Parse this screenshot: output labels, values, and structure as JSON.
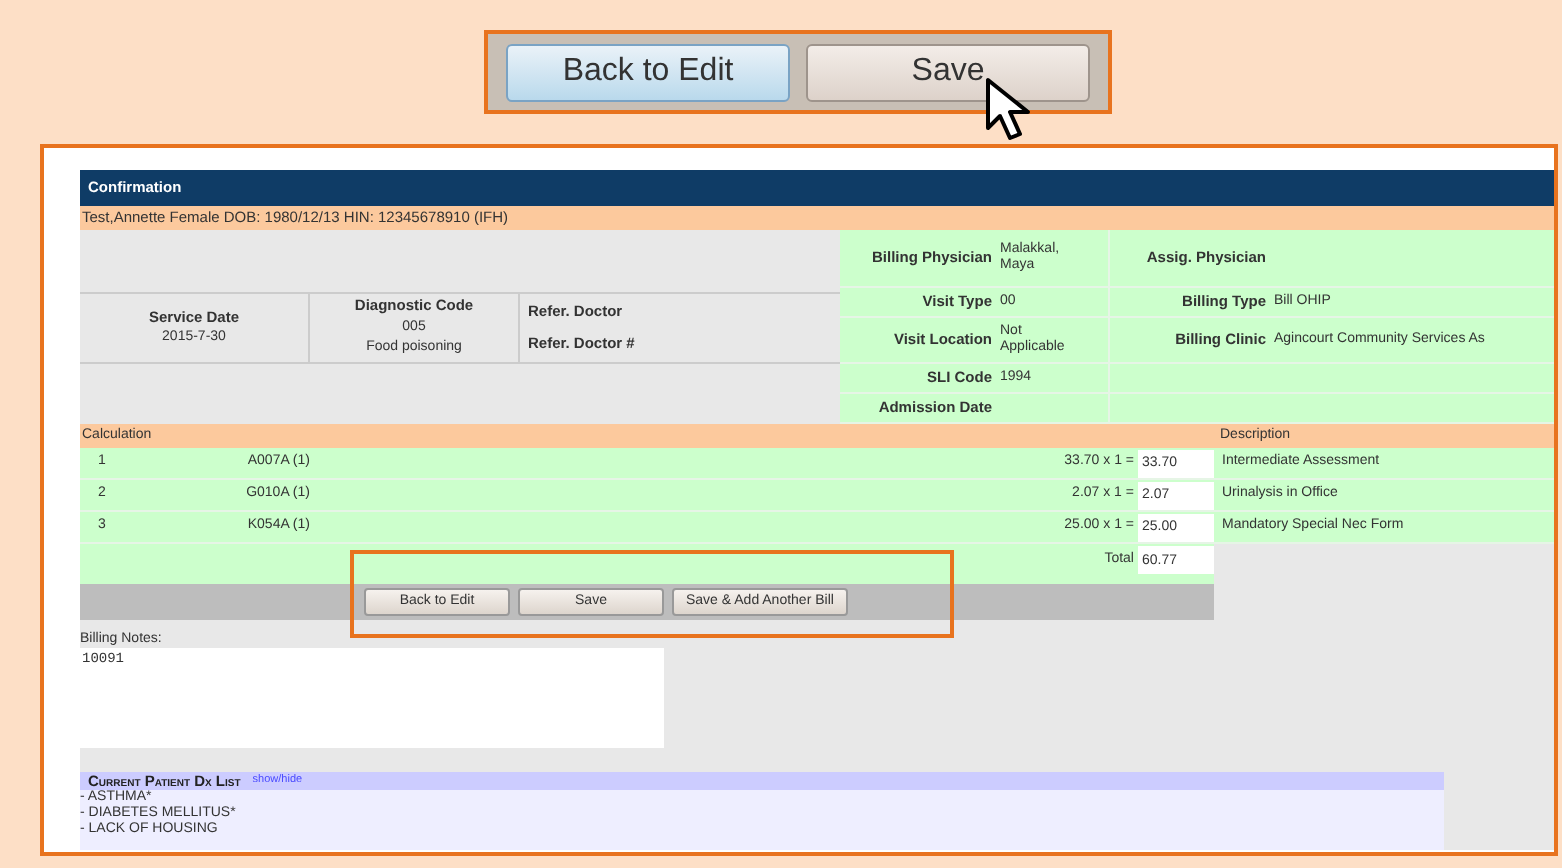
{
  "callout_buttons": [
    {
      "label": "Back to Edit",
      "focused": true
    },
    {
      "label": "Save",
      "focused": false
    }
  ],
  "window": {
    "title": "Confirmation"
  },
  "patient_banner": "Test,Annette Female DOB: 1980/12/13 HIN: 12345678910 (IFH)",
  "service": {
    "service_date_label": "Service Date",
    "service_date": "2015-7-30",
    "diagnostic_label": "Diagnostic Code",
    "diagnostic_code": "005",
    "diagnostic_name": "Food poisoning",
    "refer_doctor_label": "Refer. Doctor",
    "refer_doctor_number_label": "Refer. Doctor #"
  },
  "billing_info": [
    {
      "label": "Billing Physician",
      "value": "Malakkal, Maya",
      "label_2": "Assig. Physician"
    },
    {
      "label": "Visit Type",
      "value": "00",
      "label_2": "Billing Type",
      "value_2": "Bill OHIP"
    },
    {
      "label": "Visit Location",
      "value": "Not Applicable",
      "label_2": "Billing Clinic",
      "value_2": "Agincourt Community Services As"
    },
    {
      "label": "SLI Code",
      "value": "1994"
    },
    {
      "label": "Admission Date"
    }
  ],
  "calculation": {
    "title": "Calculation",
    "description_heading": "Description",
    "rows": [
      {
        "number": "1",
        "code": "A007A (1)",
        "formula": "33.70 x 1 =",
        "amount": "33.70",
        "description": "Intermediate Assessment"
      },
      {
        "number": "2",
        "code": "G010A (1)",
        "formula": "2.07 x 1 =",
        "amount": "2.07",
        "description": "Urinalysis in Office"
      },
      {
        "number": "3",
        "code": "K054A (1)",
        "formula": "25.00 x 1 =",
        "amount": "25.00",
        "description": "Mandatory Special Nec Form"
      }
    ],
    "total_label": "Total",
    "total": "60.77"
  },
  "form_buttons": [
    "Back to Edit",
    "Save",
    "Save & Add Another Bill"
  ],
  "billing_notes": {
    "label": "Billing Notes:",
    "value": "10091"
  },
  "dx_list": {
    "title": "Current Patient Dx List",
    "toggle": "show/hide",
    "items": [
      "- ASTHMA*",
      "- DIABETES MELLITUS*",
      "- LACK OF HOUSING"
    ]
  }
}
